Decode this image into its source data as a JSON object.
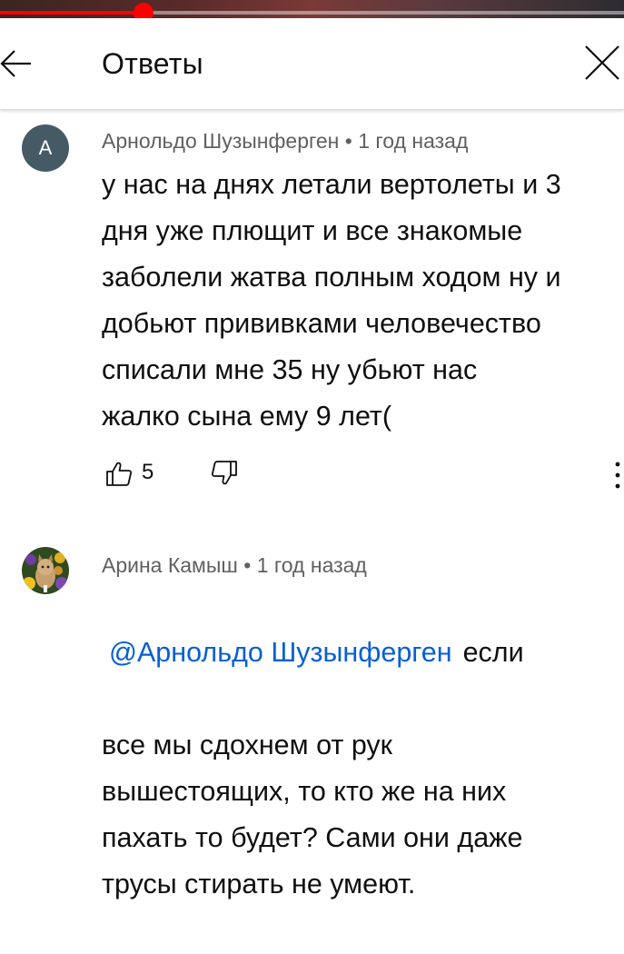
{
  "player": {
    "progress": 0.23
  },
  "header": {
    "title": "Ответы",
    "back_icon": "arrow-left-icon",
    "close_icon": "close-icon"
  },
  "comments": [
    {
      "avatar_letter": "А",
      "avatar_color": "#455a64",
      "author": "Арнольдо Шузынферген",
      "separator": "•",
      "time": "1 год назад",
      "text": "у нас на днях летали вертолеты и 3\nдня уже плющит и все знакомые\nзаболели жатва полным ходом ну и\nдобьют прививками человечество\nсписали  мне 35  ну убьют нас\nжалко сына ему 9 лет(",
      "likes": "5",
      "like_icon": "thumbs-up-icon",
      "dislike_icon": "thumbs-down-icon",
      "more_icon": "more-vertical-icon"
    },
    {
      "avatar_icon": "cat-photo-avatar",
      "author": "Арина Камыш",
      "separator": "•",
      "time": "1 год назад",
      "mention": "@Арнольдо Шузынферген",
      "first_line": "если",
      "text": "все мы сдохнем от рук\nвышестоящих, то кто же на них\nпахать то будет? Сами они даже\nтрусы стирать не умеют."
    }
  ],
  "colors": {
    "accent": "#ff0000",
    "link": "#065fd4",
    "meta": "#606060"
  }
}
